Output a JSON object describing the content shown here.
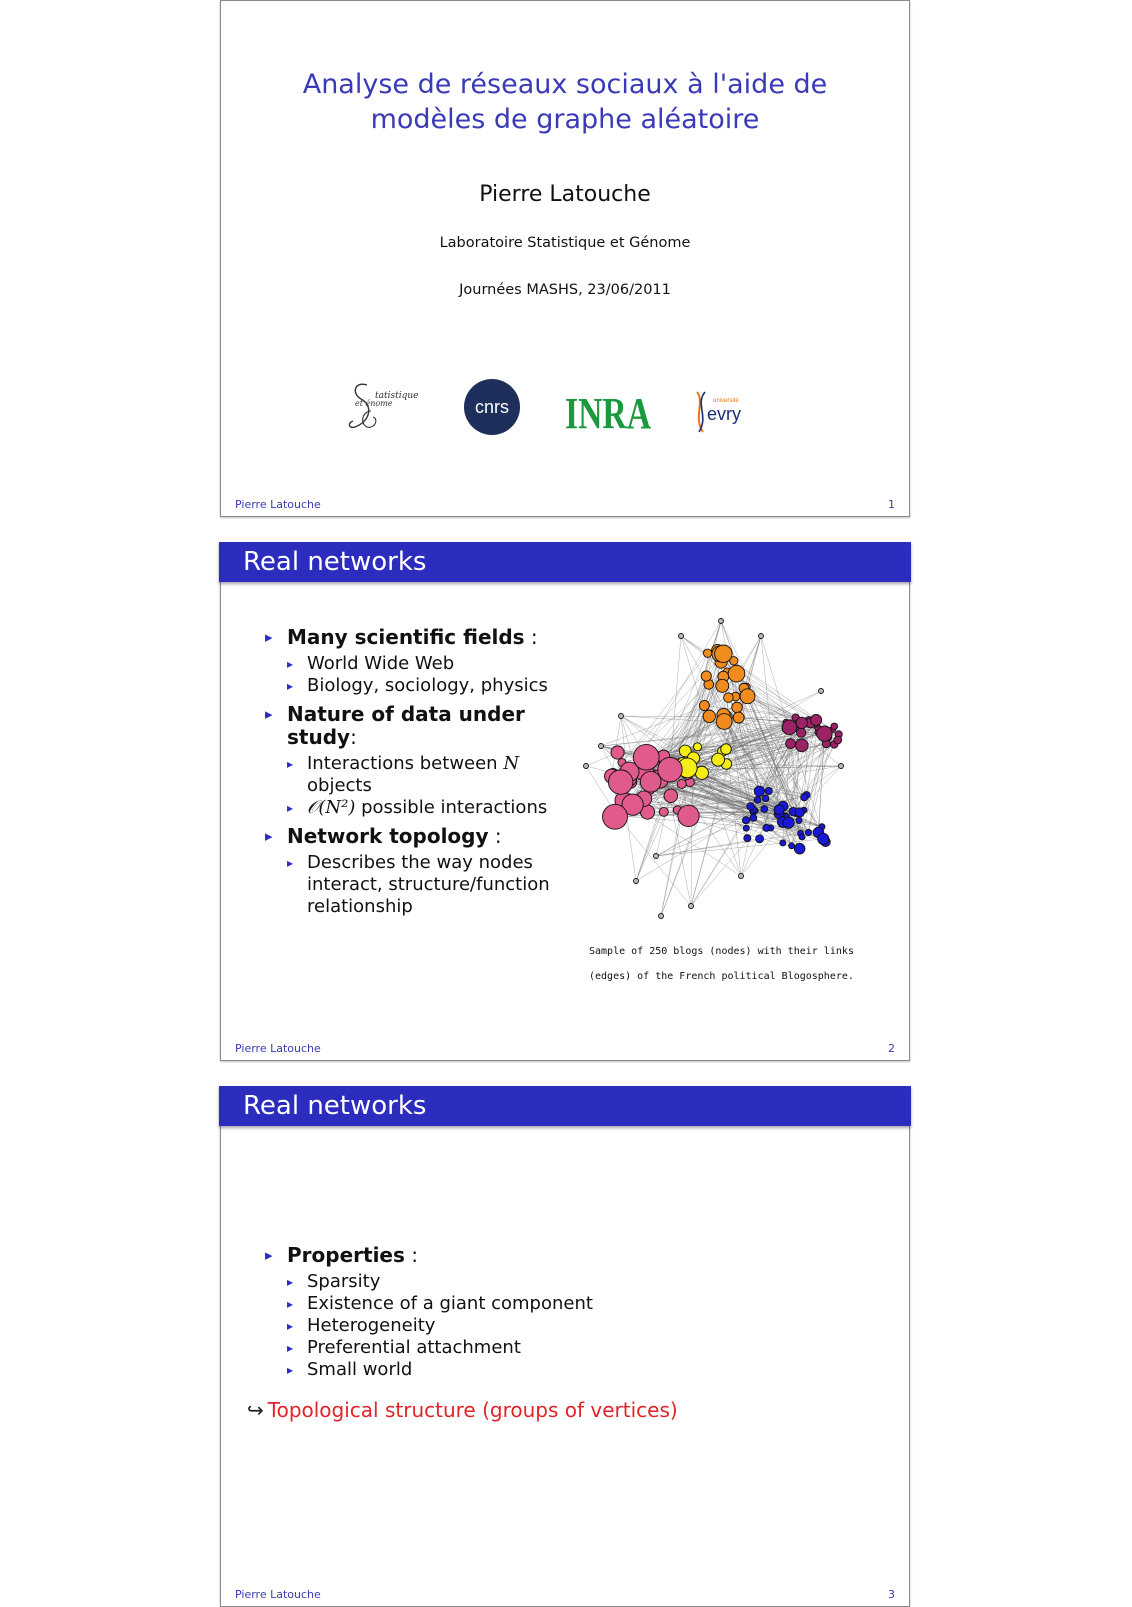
{
  "slide1": {
    "title_line1": "Analyse de réseaux sociaux à l'aide de",
    "title_line2": "modèles de graphe aléatoire",
    "author": "Pierre Latouche",
    "lab": "Laboratoire Statistique et Génome",
    "event": "Journées MASHS, 23/06/2011",
    "logo_sg_text1": "tatistique",
    "logo_sg_text2": "et énome",
    "logo_cnrs": "cnrs",
    "logo_inra": "INRA",
    "logo_evry_small": "université",
    "logo_evry": "evry",
    "footer_name": "Pierre Latouche",
    "page": "1"
  },
  "slide2": {
    "header": "Real networks",
    "b1": "Many scientific fields",
    "b1_colon": " :",
    "b1_items": [
      "World Wide Web",
      "Biology, sociology, physics"
    ],
    "b2": "Nature of data under study",
    "b2_colon": ":",
    "b2_i1_pre": "Interactions between ",
    "b2_i1_var": "N",
    "b2_i1_post": " objects",
    "b2_i2_math": "𝒪(N²)",
    "b2_i2_post": " possible interactions",
    "b3": "Network topology",
    "b3_colon": " :",
    "b3_items": [
      "Describes the way nodes interact, structure/function relationship"
    ],
    "caption_line1": "Sample of 250 blogs (nodes) with their links",
    "caption_line2": "(edges) of the French political Blogosphere.",
    "footer_name": "Pierre Latouche",
    "page": "2",
    "colors": {
      "pink": "#e05a8c",
      "orange": "#f08c1e",
      "yellow": "#f5ee16",
      "purple": "#9c2266",
      "blue": "#1a1ad6"
    }
  },
  "slide3": {
    "header": "Real networks",
    "b1": "Properties",
    "b1_colon": " :",
    "items": [
      "Sparsity",
      "Existence of a giant component",
      "Heterogeneity",
      "Preferential attachment",
      "Small world"
    ],
    "arrow_symbol": "↪",
    "conclusion": "Topological structure (groups of vertices)",
    "footer_name": "Pierre Latouche",
    "page": "3"
  }
}
